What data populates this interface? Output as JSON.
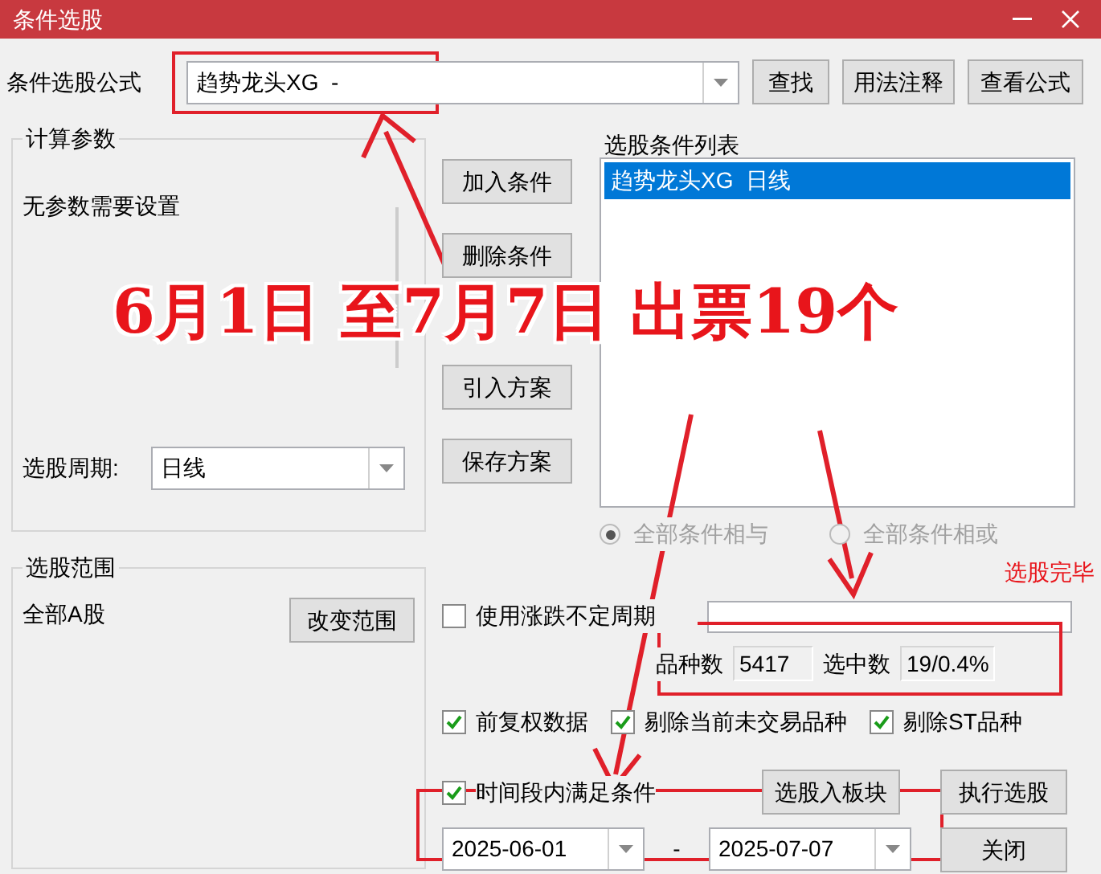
{
  "window": {
    "title": "条件选股"
  },
  "formula": {
    "label": "条件选股公式",
    "value": "趋势龙头XG  -"
  },
  "toolbar_buttons": [
    "查找",
    "用法注释",
    "查看公式"
  ],
  "params_group": {
    "title": "计算参数",
    "message": "无参数需要设置",
    "period_label": "选股周期:",
    "period_value": "日线"
  },
  "condition_buttons": [
    "加入条件",
    "删除条件"
  ],
  "scheme_buttons": [
    "引入方案",
    "保存方案"
  ],
  "condition_list": {
    "title": "选股条件列表",
    "items": [
      {
        "text": "趋势龙头XG  日线",
        "selected": true
      }
    ]
  },
  "logic": {
    "disabled": true,
    "options": [
      {
        "label": "全部条件相与",
        "selected": true
      },
      {
        "label": "全部条件相或",
        "selected": false
      }
    ]
  },
  "status": "选股完毕",
  "range_group": {
    "title": "选股范围",
    "value": "全部A股",
    "button": "改变范围"
  },
  "variable_period": {
    "label": "使用涨跌不定周期",
    "checked": false
  },
  "stats": [
    {
      "label": "品种数",
      "value": "5417"
    },
    {
      "label": "选中数",
      "value": "19/0.4%"
    }
  ],
  "options": [
    {
      "label": "前复权数据",
      "checked": true
    },
    {
      "label": "剔除当前未交易品种",
      "checked": true
    },
    {
      "label": "剔除ST品种",
      "checked": true
    }
  ],
  "time_range": {
    "label": "时间段内满足条件",
    "checked": true,
    "start": "2025-06-01",
    "separator": "-",
    "end": "2025-07-07"
  },
  "action_buttons": [
    "选股入板块",
    "执行选股",
    "关闭"
  ],
  "annotation": {
    "text": "6月1日 至7月7日 出票19个"
  }
}
